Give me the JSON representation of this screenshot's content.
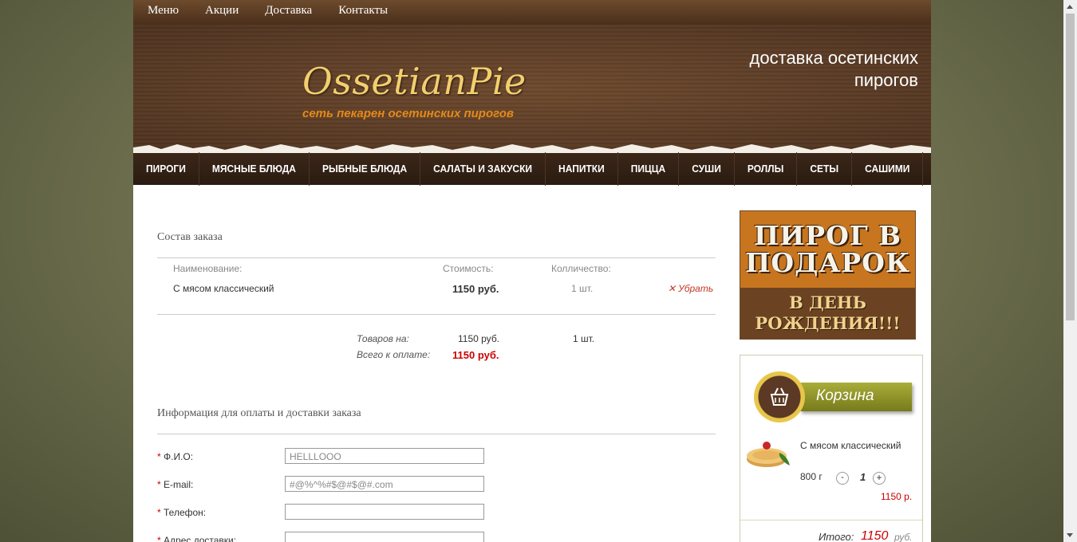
{
  "topnav": [
    "Меню",
    "Акции",
    "Доставка",
    "Контакты"
  ],
  "header": {
    "logo_title": "OssetianPie",
    "logo_sub": "сеть пекарен осетинских пирогов",
    "phone1": "",
    "phone2": "",
    "delivery_line1": "доставка осетинских",
    "delivery_line2": "пирогов"
  },
  "categories": [
    "ПИРОГИ",
    "МЯСНЫЕ БЛЮДА",
    "РЫБНЫЕ БЛЮДА",
    "САЛАТЫ И ЗАКУСКИ",
    "НАПИТКИ",
    "ПИЦЦА",
    "СУШИ",
    "РОЛЛЫ",
    "СЕТЫ",
    "САШИМИ"
  ],
  "order": {
    "title": "Состав заказа",
    "col_name": "Наименование:",
    "col_price": "Стоимость:",
    "col_qty": "Колличество:",
    "item_name": "С мясом классический",
    "item_price": "1150 руб.",
    "item_qty": "1",
    "item_unit": "шт.",
    "remove_label": "Убрать",
    "goods_label": "Товаров на:",
    "goods_sum": "1150 руб.",
    "goods_qty": "1 шт.",
    "total_label": "Всего к оплате:",
    "total_sum": "1150 руб."
  },
  "form": {
    "title": "Информация для оплаты и доставки заказа",
    "req": "*",
    "fio_label": "Ф.И.О:",
    "fio_value": "HELLLOOO",
    "email_label": "E-mail:",
    "email_value": "#@%^%#$@#$@#.com",
    "phone_label": "Телефон:",
    "phone_value": "",
    "address_label": "Адрес доставки:"
  },
  "promo": {
    "line1": "ПИРОГ В",
    "line2": "ПОДАРОК",
    "line3": "В ДЕНЬ",
    "line4": "РОЖДЕНИЯ!!!"
  },
  "cart": {
    "title": "Корзина",
    "item_name": "С мясом классический",
    "weight": "800 г",
    "qty": "1",
    "minus": "-",
    "plus": "+",
    "price": "1150 р.",
    "total_label": "Итого:",
    "total_value": "1150",
    "total_unit": "руб."
  },
  "colors": {
    "accent_red": "#cc0000",
    "logo_gold": "#f2cf6e",
    "logo_orange": "#e58a1a",
    "nav_brown": "#2f1e12"
  }
}
